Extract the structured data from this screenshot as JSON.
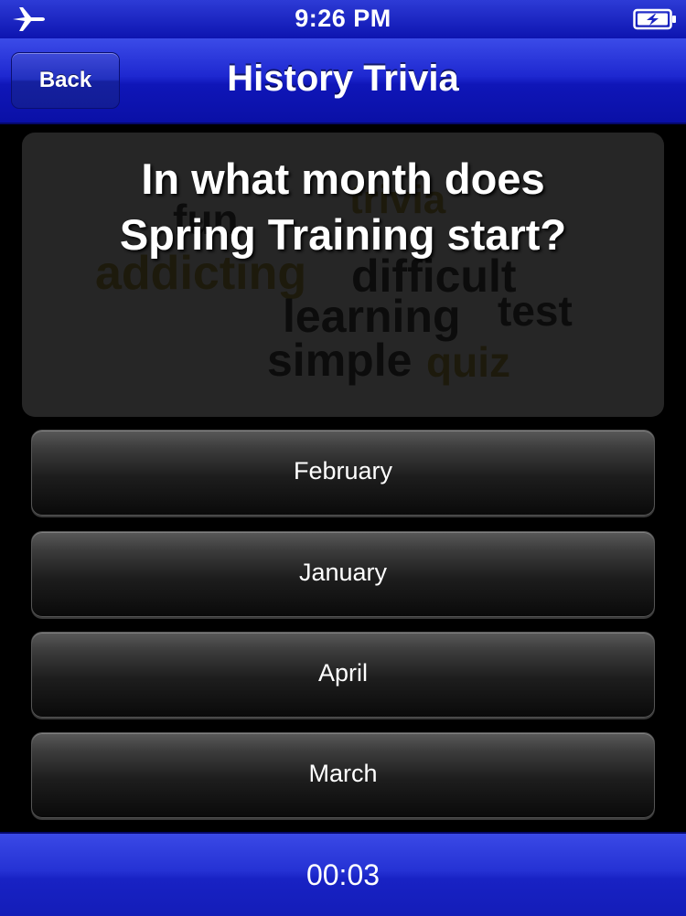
{
  "status_bar": {
    "time": "9:26 PM",
    "icons": [
      "airplane-icon",
      "battery-charging-icon"
    ]
  },
  "nav": {
    "back_label": "Back",
    "title": "History Trivia"
  },
  "question": {
    "text_line1": "In what month does",
    "text_line2": "Spring Training start?",
    "background_words": [
      "trivia",
      "fun",
      "addicting",
      "difficult",
      "learning",
      "test",
      "simple",
      "quiz"
    ]
  },
  "answers": [
    {
      "label": "February"
    },
    {
      "label": "January"
    },
    {
      "label": "April"
    },
    {
      "label": "March"
    }
  ],
  "timer": "00:03",
  "colors": {
    "bar_blue": "#1e28d0",
    "background": "#000000",
    "card": "#262626"
  }
}
